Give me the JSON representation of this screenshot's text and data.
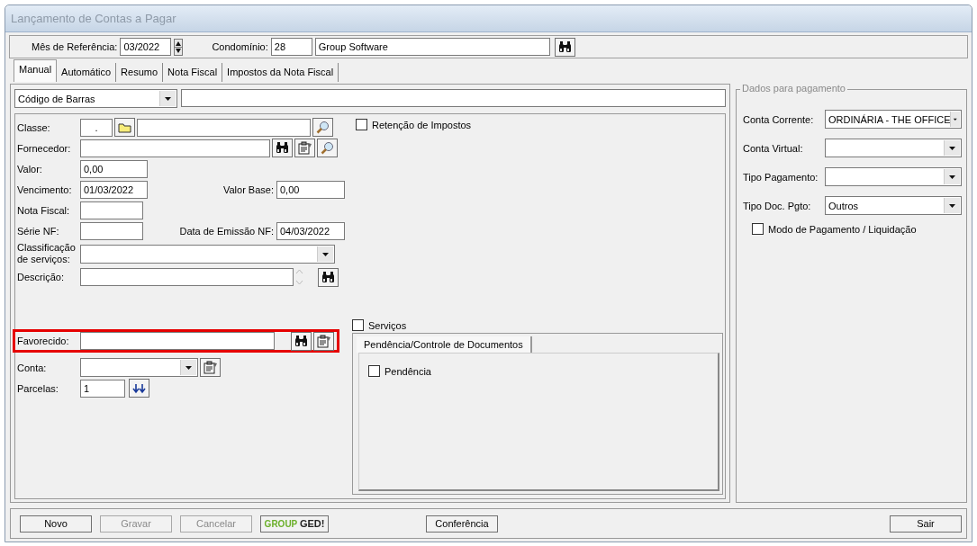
{
  "window": {
    "title": "Lançamento de Contas a Pagar"
  },
  "header": {
    "month_label": "Mês de Referência:",
    "month_value": "03/2022",
    "condo_label": "Condomínio:",
    "condo_code": "28",
    "condo_name": "Group Software"
  },
  "tabs": [
    {
      "label": "Manual",
      "selected": true
    },
    {
      "label": "Automático",
      "selected": false
    },
    {
      "label": "Resumo",
      "selected": false
    },
    {
      "label": "Nota Fiscal",
      "selected": false
    },
    {
      "label": "Impostos da Nota Fiscal",
      "selected": false
    }
  ],
  "barcode": {
    "type": "Código de Barras"
  },
  "fields": [
    {
      "kind": "classe",
      "label": "Classe:",
      "value": "."
    },
    {
      "kind": "fornecedor",
      "label": "Fornecedor:"
    },
    {
      "kind": "valor",
      "label": "Valor:",
      "value": "0,00"
    },
    {
      "kind": "vencimento",
      "label": "Vencimento:",
      "value": "01/03/2022",
      "extra_label": "Valor Base:",
      "extra_value": "0,00"
    },
    {
      "kind": "nota",
      "label": "Nota Fiscal:"
    },
    {
      "kind": "serie",
      "label": "Série NF:",
      "extra_label": "Data de Emissão NF:",
      "extra_value": "04/03/2022"
    },
    {
      "kind": "classificacao",
      "label": "Classificação de serviços:"
    },
    {
      "kind": "descricao",
      "label": "Descrição:"
    },
    {
      "kind": "favorecido",
      "label": "Favorecido:",
      "highlighted": true
    },
    {
      "kind": "conta",
      "label": "Conta:"
    },
    {
      "kind": "parcelas",
      "label": "Parcelas:",
      "value": "1"
    }
  ],
  "retencao": {
    "label": "Retenção de Impostos",
    "checked": false
  },
  "servicos": {
    "label": "Serviços",
    "checked": false
  },
  "sub_tabs": [
    {
      "label": "Pendência/Controle de Documentos",
      "selected": true
    }
  ],
  "pendencia": {
    "label": "Pendência",
    "checked": false
  },
  "payment": {
    "legend": "Dados para pagamento",
    "combos": [
      {
        "label": "Conta Corrente:",
        "value": "ORDINÁRIA - THE OFFICE"
      },
      {
        "label": "Conta Virtual:"
      },
      {
        "label": "Tipo Pagamento:"
      },
      {
        "label": "Tipo Doc. Pgto:",
        "value": "Outros"
      }
    ],
    "mode": {
      "label": "Modo de Pagamento / Liquidação",
      "checked": false
    }
  },
  "buttons": [
    {
      "kind": "text",
      "label": "Novo",
      "disabled": false
    },
    {
      "kind": "text",
      "label": "Gravar",
      "disabled": true
    },
    {
      "kind": "text",
      "label": "Cancelar",
      "disabled": true
    },
    {
      "kind": "logo",
      "label": "GROUP",
      "label2": "GED!",
      "disabled": false
    },
    {
      "kind": "text",
      "label": "Conferência",
      "disabled": false
    },
    {
      "kind": "spacer_text",
      "label": "Sair",
      "disabled": false
    }
  ]
}
